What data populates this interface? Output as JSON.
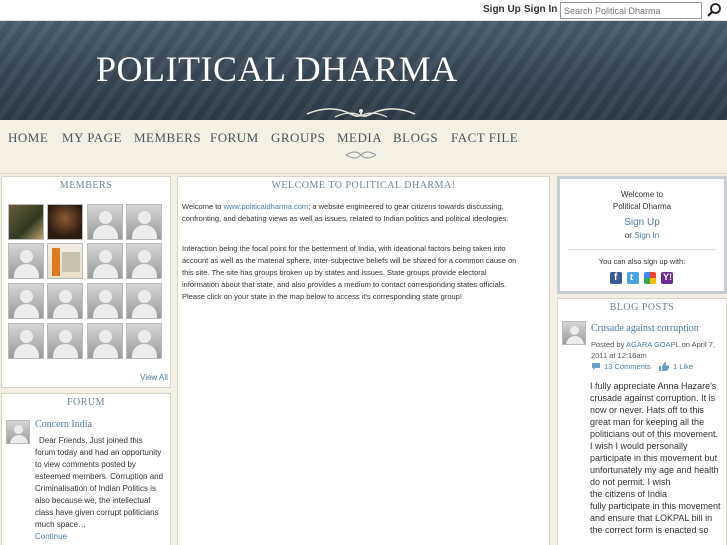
{
  "topbar": {
    "sign_up": "Sign Up",
    "sign_in": "Sign In",
    "search_placeholder": "Search Political Dharma",
    "search_icon": "magnifier-icon"
  },
  "header": {
    "site_title": "POLITICAL DHARMA"
  },
  "nav": {
    "items": [
      "HOME",
      "MY PAGE",
      "MEMBERS",
      "FORUM",
      "GROUPS",
      "MEDIA",
      "BLOGS",
      "FACT FILE"
    ]
  },
  "members": {
    "title": "MEMBERS",
    "view_all": "View All"
  },
  "forum": {
    "title": "FORUM",
    "post_title": "Concern India",
    "post_lines": [
      "Dear Friends,  Just joined this",
      "forum today and had an opportunity",
      "to view comments posted by",
      "esteemed members. Corruption and",
      "Criminalisation of Indian Politics is",
      "also because we, the intellectual",
      "class have given corrupt politicians",
      "much space…"
    ],
    "continue": "Continue"
  },
  "welcome": {
    "title": "WELCOME TO POLITICAL DHARMA!",
    "intro_prefix": "Welcome to",
    "site_link": "www.politicaldharma.com",
    "intro_lines": [
      "; a website engineered to gear citizens towards discussing,",
      "confronting, and debating views as well as issues, related to Indian politics and political ideologies."
    ],
    "para2_lines": [
      "Interaction being the focal point for the betterment of India, with ideational factors being taken into",
      "account as well as the material sphere, inter-subjective beliefs will be shared for a common cause on",
      "this site. The site has groups broken up by states and issues. State groups provide electoral",
      "information about that state, and also provides a medium to contact corresponding states officials.",
      "Please click on your state in the map below to access it's corresponding state group!"
    ]
  },
  "signup_box": {
    "welcome_line1": "Welcome to",
    "welcome_line2": "Political Dharma",
    "sign_up": "Sign Up",
    "or": "or",
    "sign_in": "Sign In",
    "also_text": "You can also sign up with:",
    "services": [
      "facebook-icon",
      "twitter-icon",
      "google-icon",
      "yahoo-icon"
    ]
  },
  "blog": {
    "title": "BLOG POSTS",
    "post_title": "Crusade against corruption",
    "posted_by": "Posted by",
    "author": "AGARA GOAPL",
    "date_prefix": "on April 7,",
    "date_line2": "2011 at 12:16am",
    "comments": "13 Comments",
    "likes": "1 Like",
    "body_lines": [
      "I fully appreciate Anna Hazare's",
      "crusade against corruption. It is",
      "now or never. Hats off to this",
      "great man for keeping all the",
      "politicians out of this movement.",
      "I wish I would personally",
      "participate in this movement but",
      "unfortunately my age and health",
      "do not permit. I wish",
      "the citizens of India",
      "fully participate in this movement",
      "and ensure that LOKPAL bill in",
      "the correct form is enacted so"
    ]
  },
  "colors": {
    "header_bg": "#3a4a58",
    "page_bg": "#f3efe2",
    "link": "#4a7ca6",
    "panel_title": "#6f8796"
  }
}
